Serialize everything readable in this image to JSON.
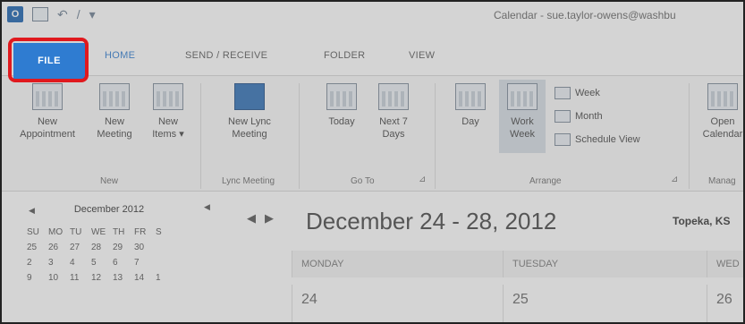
{
  "window": {
    "title": "Calendar - sue.taylor-owens@washbu"
  },
  "tabs": {
    "file": "FILE",
    "home": "HOME",
    "send_receive": "SEND / RECEIVE",
    "folder": "FOLDER",
    "view": "VIEW"
  },
  "ribbon": {
    "new_appointment": [
      "New",
      "Appointment"
    ],
    "new_meeting": [
      "New",
      "Meeting"
    ],
    "new_items": [
      "New",
      "Items ▾"
    ],
    "new_lync": [
      "New Lync",
      "Meeting"
    ],
    "today": [
      "Today",
      ""
    ],
    "next7": [
      "Next 7",
      "Days"
    ],
    "day": [
      "Day",
      ""
    ],
    "work_week": [
      "Work",
      "Week"
    ],
    "week": "Week",
    "month": "Month",
    "schedule_view": "Schedule View",
    "open_calendar": [
      "Open",
      "Calendar"
    ],
    "groups": {
      "new": "New",
      "lync": "Lync Meeting",
      "goto": "Go To",
      "arrange": "Arrange",
      "manage": "Manag"
    }
  },
  "mini_calendar": {
    "month": "December 2012",
    "weekdays": [
      "SU",
      "MO",
      "TU",
      "WE",
      "TH",
      "FR",
      "S"
    ],
    "rows": [
      [
        "25",
        "26",
        "27",
        "28",
        "29",
        "30",
        ""
      ],
      [
        "2",
        "3",
        "4",
        "5",
        "6",
        "7",
        ""
      ],
      [
        "9",
        "10",
        "11",
        "12",
        "13",
        "14",
        "1"
      ]
    ]
  },
  "calendar": {
    "range": "December 24 - 28, 2012",
    "location": "Topeka, KS",
    "days": [
      {
        "name": "MONDAY",
        "num": "24"
      },
      {
        "name": "TUESDAY",
        "num": "25"
      },
      {
        "name": "WED",
        "num": "26"
      }
    ]
  },
  "colors": {
    "file_tab": "#2f7cd1",
    "highlight": "#e0191e"
  }
}
